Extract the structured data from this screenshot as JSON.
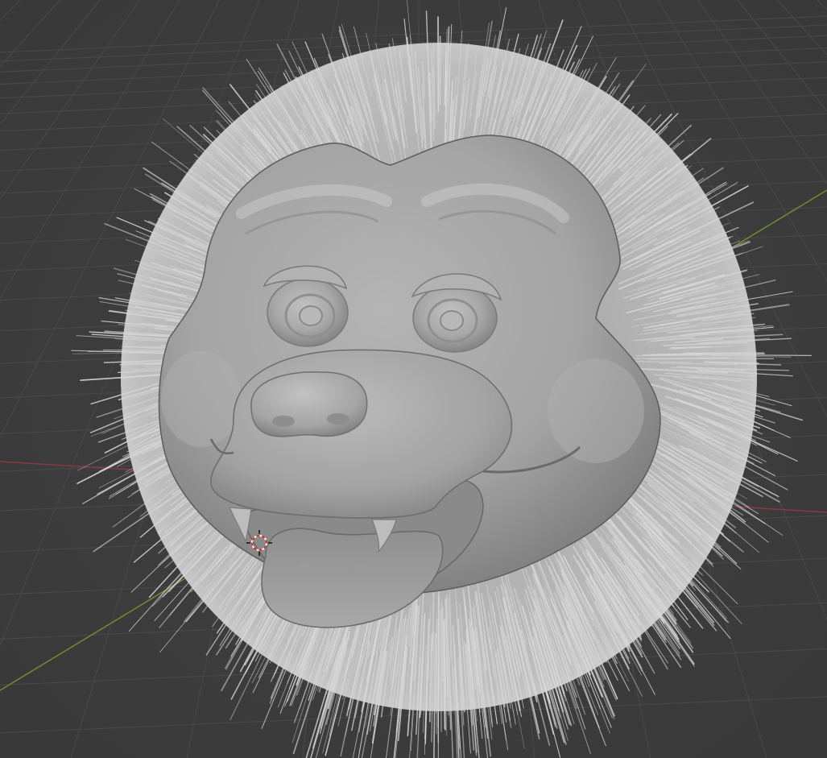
{
  "viewport": {
    "background_color": "#3d3d3d",
    "grid_color": "#4a4a4a",
    "x_axis_color": "#9b3a42",
    "y_axis_color": "#6f8f2e",
    "mesh_color": "#a9a9a9",
    "hair_color": "#d8d8d8",
    "cursor_colors": [
      "#d0342c",
      "#ffffff"
    ]
  },
  "objects": [
    {
      "name": "sculpted-head-mesh",
      "icon": "mesh-object",
      "selected": false
    },
    {
      "name": "hair-particles",
      "icon": "particle-system"
    },
    {
      "name": "3d-cursor",
      "icon": "crosshair-icon"
    }
  ]
}
